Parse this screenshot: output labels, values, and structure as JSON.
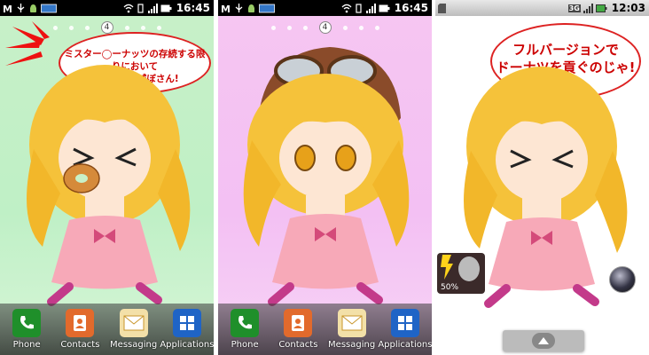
{
  "screens": [
    {
      "status": {
        "time": "16:45"
      },
      "page_indicator": "4",
      "bubble_line1": "ミスター◯ーナッツの存続する限りにおいて",
      "bubble_line2": "儂は人類を滅ぼさん!",
      "dock": [
        {
          "label": "Phone",
          "icon": "phone-icon",
          "color": "#1f8f2a"
        },
        {
          "label": "Contacts",
          "icon": "contacts-icon",
          "color": "#e26a2c"
        },
        {
          "label": "Messaging",
          "icon": "messaging-icon",
          "color": "#d9a43a"
        },
        {
          "label": "Applications",
          "icon": "grid-icon",
          "color": "#1f64c6"
        }
      ]
    },
    {
      "status": {
        "time": "16:45"
      },
      "page_indicator": "4",
      "dock": [
        {
          "label": "Phone",
          "icon": "phone-icon",
          "color": "#1f8f2a"
        },
        {
          "label": "Contacts",
          "icon": "contacts-icon",
          "color": "#e26a2c"
        },
        {
          "label": "Messaging",
          "icon": "messaging-icon",
          "color": "#d9a43a"
        },
        {
          "label": "Applications",
          "icon": "grid-icon",
          "color": "#1f64c6"
        }
      ]
    },
    {
      "status": {
        "time": "12:03",
        "network": "3G"
      },
      "bubble_line1": "フルバージョンで",
      "bubble_line2": "ドーナツを貢ぐのじゃ!",
      "battery_widget": "50%"
    }
  ]
}
